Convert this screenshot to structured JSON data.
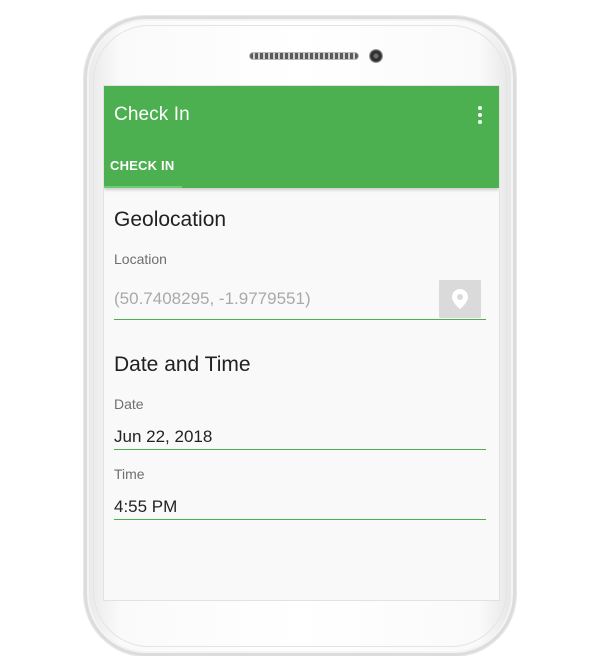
{
  "app": {
    "title": "Check In",
    "menu_icon": "more-vertical-icon"
  },
  "tabs": [
    {
      "label": "CHECK IN",
      "selected": true
    }
  ],
  "geolocation": {
    "heading": "Geolocation",
    "location_label": "Location",
    "location_value": "(50.7408295, -1.9779551)",
    "location_button_icon": "location-pin-icon"
  },
  "datetime": {
    "heading": "Date and Time",
    "date_label": "Date",
    "date_value": "Jun 22, 2018",
    "time_label": "Time",
    "time_value": "4:55 PM"
  },
  "colors": {
    "primary": "#4caf50",
    "tab_indicator": "#6ccc70",
    "hint_text": "#a9a9a9",
    "button_bg": "#dadada"
  }
}
